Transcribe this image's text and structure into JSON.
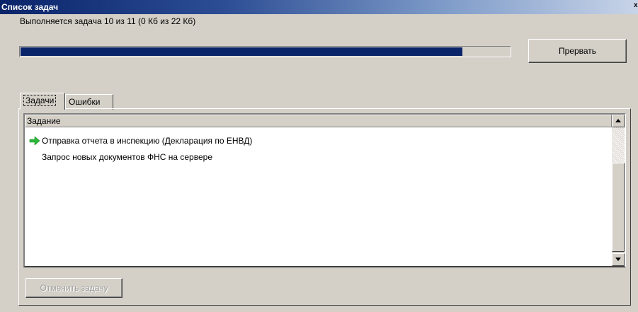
{
  "window": {
    "title": "Список задач",
    "close_glyph": "x"
  },
  "status": {
    "text": "Выполняется задача 10 из 11 (0 Кб из 22 Кб)"
  },
  "progress": {
    "fraction": 0.903,
    "fill_color": "#0a246a"
  },
  "buttons": {
    "stop": "Прервать",
    "cancel_task": "Отменить задачу"
  },
  "tabs": [
    {
      "label": "Задачи",
      "active": true
    },
    {
      "label": "Ошибки",
      "active": false
    }
  ],
  "list": {
    "column_header": "Задание",
    "rows": [
      {
        "text": "Отправка отчета в инспекцию (Декларация по ЕНВД)",
        "icon": "green-arrow-icon",
        "active": true
      },
      {
        "text": "Запрос новых документов ФНС на сервере",
        "icon": "",
        "active": false
      }
    ]
  },
  "colors": {
    "accent": "#0a246a",
    "arrow": "#2db83a",
    "face": "#d4d0c8"
  }
}
